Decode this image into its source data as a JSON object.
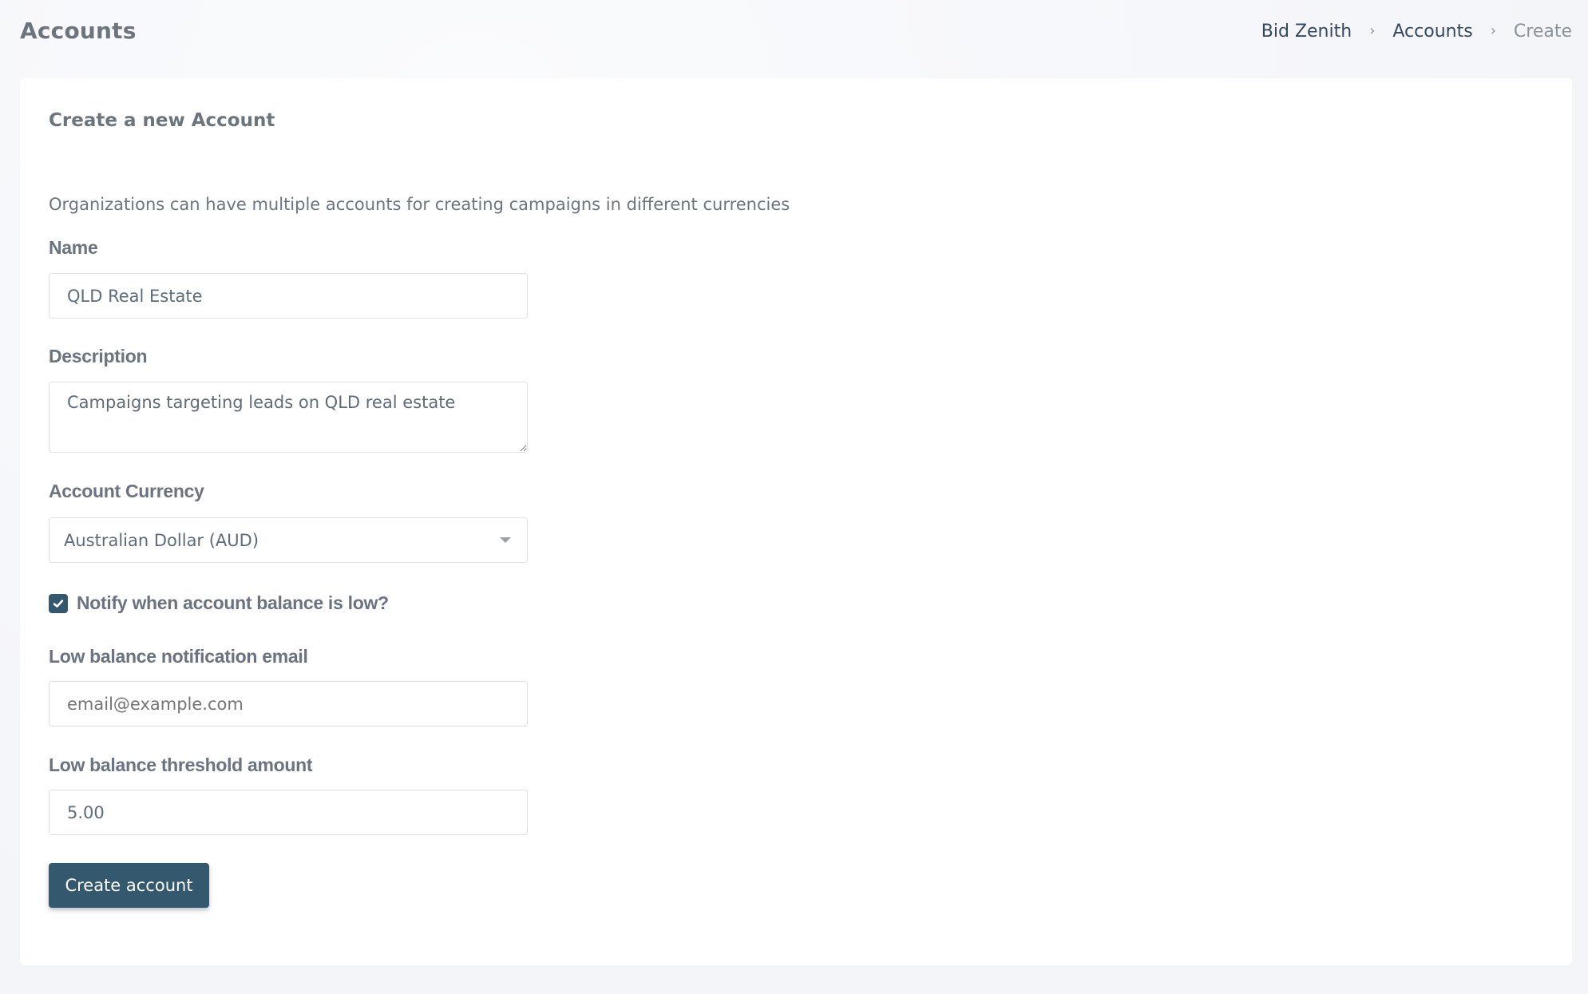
{
  "header": {
    "title": "Accounts",
    "breadcrumb": [
      {
        "label": "Bid Zenith",
        "active": false
      },
      {
        "label": "Accounts",
        "active": false
      },
      {
        "label": "Create",
        "active": true
      }
    ],
    "breadcrumb_separator": "›"
  },
  "card": {
    "title": "Create a new Account",
    "intro": "Organizations can have multiple accounts for creating campaigns in different currencies"
  },
  "form": {
    "name": {
      "label": "Name",
      "value": "QLD Real Estate"
    },
    "description": {
      "label": "Description",
      "value": "Campaigns targeting leads on QLD real estate"
    },
    "currency": {
      "label": "Account Currency",
      "selected": "Australian Dollar (AUD)"
    },
    "notify": {
      "label": "Notify when account balance is low?",
      "checked": true
    },
    "email": {
      "label": "Low balance notification email",
      "value": "",
      "placeholder": "email@example.com"
    },
    "threshold": {
      "label": "Low balance threshold amount",
      "value": "5.00"
    },
    "submit_label": "Create account"
  },
  "colors": {
    "primary": "#34586d",
    "background": "#f5f6fa",
    "card": "#ffffff",
    "text": "#6c757d",
    "breadcrumb_link": "#34495e",
    "breadcrumb_active": "#8a939c"
  }
}
